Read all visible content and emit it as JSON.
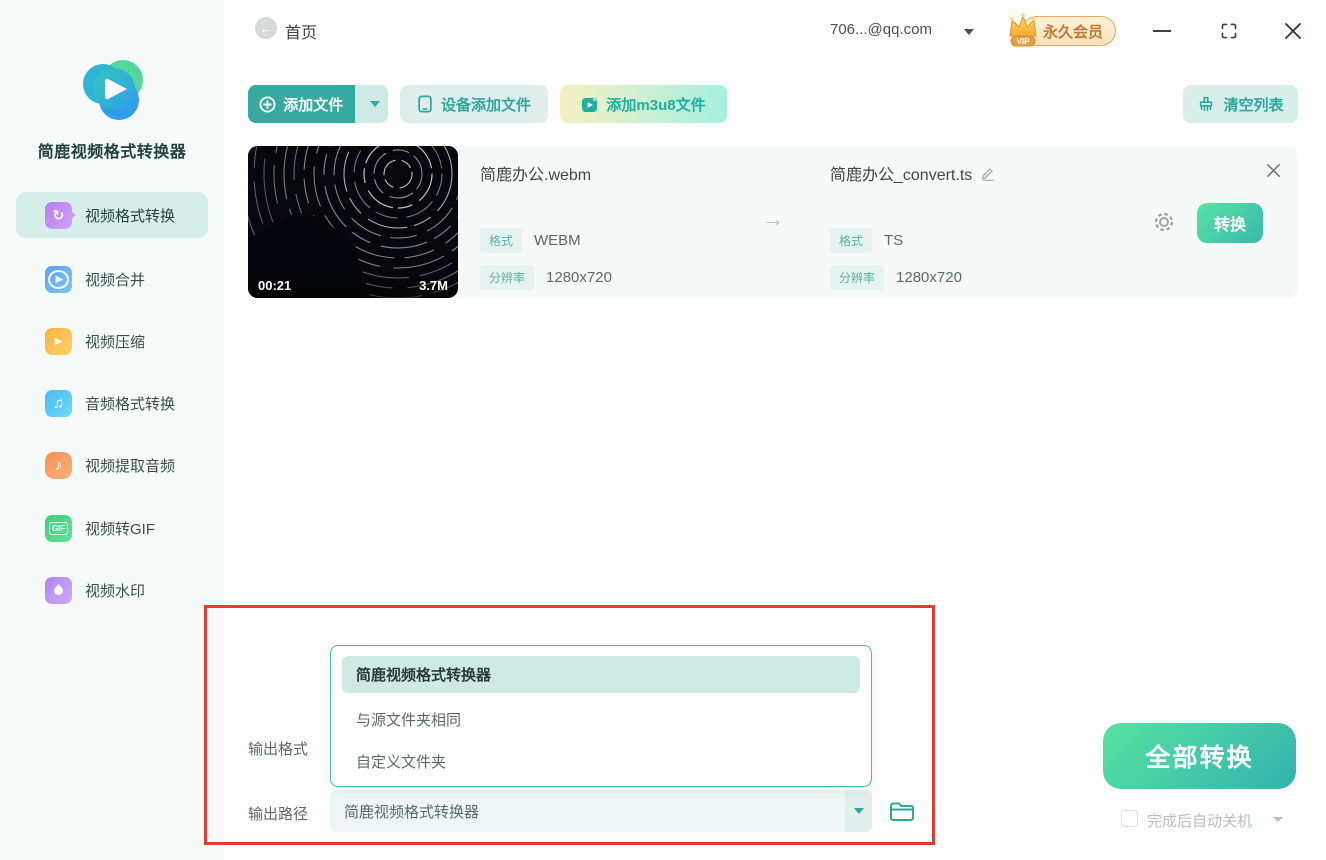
{
  "app": {
    "name": "简鹿视频格式转换器"
  },
  "sidebar": {
    "items": [
      {
        "label": "视频格式转换",
        "icon": "video-convert-icon",
        "active": true
      },
      {
        "label": "视频合并",
        "icon": "video-merge-icon",
        "active": false
      },
      {
        "label": "视频压缩",
        "icon": "video-compress-icon",
        "active": false
      },
      {
        "label": "音频格式转换",
        "icon": "audio-convert-icon",
        "active": false
      },
      {
        "label": "视频提取音频",
        "icon": "extract-audio-icon",
        "active": false
      },
      {
        "label": "视频转GIF",
        "icon": "video-to-gif-icon",
        "active": false
      },
      {
        "label": "视频水印",
        "icon": "watermark-icon",
        "active": false
      }
    ]
  },
  "header": {
    "home": "首页",
    "account": "706...@qq.com",
    "vip_tag": "VIP",
    "vip_label": "永久会员"
  },
  "toolbar": {
    "add_file": "添加文件",
    "device_add": "设备添加文件",
    "add_m3u8": "添加m3u8文件",
    "clear_list": "清空列表"
  },
  "file_card": {
    "duration": "00:21",
    "size": "3.7M",
    "source": {
      "name": "简鹿办公.webm",
      "format_label": "格式",
      "format": "WEBM",
      "resolution_label": "分辨率",
      "resolution": "1280x720"
    },
    "target": {
      "name": "简鹿办公_convert.ts",
      "format_label": "格式",
      "format": "TS",
      "resolution_label": "分辨率",
      "resolution": "1280x720"
    },
    "convert_label": "转换"
  },
  "output": {
    "format_label": "输出格式",
    "path_label": "输出路径",
    "options": [
      "简鹿视频格式转换器",
      "与源文件夹相同",
      "自定义文件夹"
    ],
    "selected_option": "简鹿视频格式转换器",
    "path_value": "简鹿视频格式转换器"
  },
  "footer": {
    "convert_all": "全部转换",
    "shutdown": "完成后自动关机"
  },
  "icons": {
    "back": "arrow-left-icon",
    "crown": "vip-crown-icon",
    "minimize": "minimize-icon",
    "maximize": "maximize-icon",
    "close": "close-icon",
    "plus": "plus-circle-icon",
    "device": "phone-icon",
    "m3u8": "video-file-icon",
    "clear": "broom-icon",
    "edit": "pencil-icon",
    "settings": "gear-icon",
    "folder": "folder-icon"
  },
  "colors": {
    "accent": "#2fa89c",
    "accent_dark": "#36aaa0",
    "sidebar_bg": "#f6fbf9",
    "active_item_bg": "#d7efeb",
    "card_bg": "#f5f9f8",
    "tag_bg": "#e7f3f1",
    "convert_gradient_from": "#57e3a0",
    "convert_gradient_to": "#32b3af",
    "highlight_red": "#e83a2e",
    "vip_border": "#f0a75e",
    "vip_text": "#c07a33"
  }
}
